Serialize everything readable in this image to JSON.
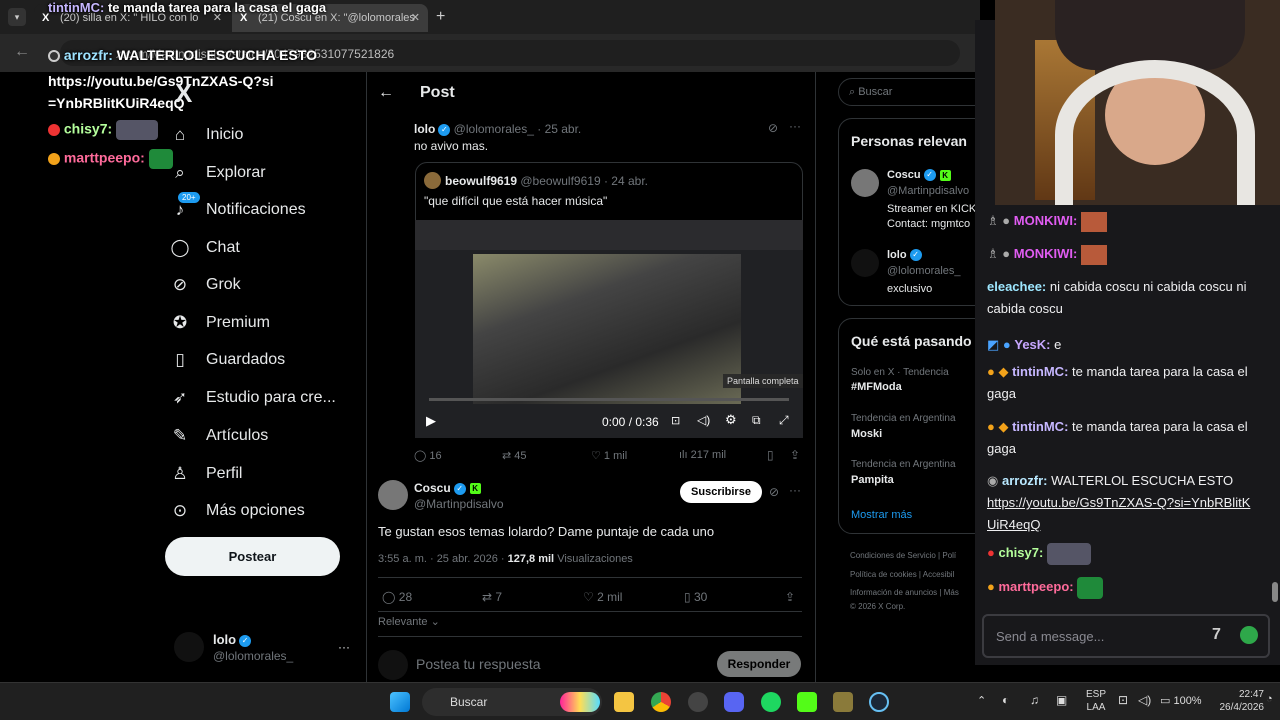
{
  "browser": {
    "tab1": "(20) silla en X: \"",
    "tab1b": "HILO con lo",
    "tab2": "(21) Coscu en X: \"@lolomorales",
    "new_tab": "+",
    "url": "x.com/Martinpdisalvo/status/2047932531077521826",
    "back": "←"
  },
  "overlay": [
    {
      "user": "tintinMC:",
      "text": "te manda tarea para la casa el gaga"
    },
    {
      "user": "arrozfr:",
      "text": "WALTERLOL ESCUCHA ESTO"
    },
    {
      "user": "",
      "text": "https://youtu.be/Gs9TnZXAS-Q?si=YnbRBlitKUiR4eqQ"
    },
    {
      "user": "chisy7:",
      "text": ""
    },
    {
      "user": "marttpeepo:",
      "text": ""
    }
  ],
  "nav": {
    "logo": "X",
    "items": [
      "Inicio",
      "Explorar",
      "Notificaciones",
      "Chat",
      "Grok",
      "Premium",
      "Guardados",
      "Estudio para cre...",
      "Artículos",
      "Perfil",
      "Más opciones"
    ],
    "notif_badge": "20+",
    "post_button": "Postear",
    "account_name": "lolo",
    "account_handle": "@lolomorales_",
    "more": "···"
  },
  "post": {
    "header": "Post",
    "back": "←",
    "tweet1": {
      "name": "lolo",
      "handle": "@lolomorales_",
      "date": "· 25 abr.",
      "text": "no avivo mas."
    },
    "quote": {
      "name": "beowulf9619",
      "handle": "@beowulf9619",
      "date": "· 24 abr.",
      "text": "\"que difícil que está hacer música\"",
      "time": "0:00 / 0:36",
      "fullscreen": "Pantalla completa"
    },
    "stats1": {
      "replies": "16",
      "retweets": "45",
      "likes": "1 mil",
      "views": "217 mil"
    },
    "tweet2": {
      "name": "Coscu",
      "handle": "@Martinpdisalvo",
      "subscribe": "Suscribirse",
      "text": "Te gustan esos temas lolardo? Dame puntaje de cada uno",
      "meta": "3:55 a. m. · 25 abr. 2026 · ",
      "views_num": "127,8 mil",
      "views_label": "Visualizaciones"
    },
    "stats2": {
      "replies": "28",
      "retweets": "7",
      "likes": "2 mil",
      "bookmarks": "30"
    },
    "sort": "Relevante",
    "reply_placeholder": "Postea tu respuesta",
    "reply_button": "Responder"
  },
  "right": {
    "search": "Buscar",
    "people_title": "Personas relevan",
    "p1_name": "Coscu",
    "p1_handle": "@Martinpdisalvo",
    "p1_bio1": "Streamer en KICK",
    "p1_bio2": "Contact: mgmtco",
    "p2_name": "lolo",
    "p2_handle": "@lolomorales_",
    "p2_bio": "exclusivo",
    "trends_title": "Qué está pasando",
    "t1_ctx": "Solo en X · Tendencia",
    "t1": "#MFModa",
    "t2_ctx": "Tendencia en Argentina",
    "t2": "Moski",
    "t3_ctx": "Tendencia en Argentina",
    "t3": "Pampita",
    "show_more": "Mostrar más",
    "footer1": "Condiciones de Servicio",
    "footer1b": "Polí",
    "footer2": "Política de cookies",
    "footer2b": "Accesibil",
    "footer3": "Información de anuncios",
    "footer3b": "Más",
    "footer4": "© 2026 X Corp."
  },
  "chat": {
    "lines": [
      {
        "user": "MONKIWI:",
        "text": "",
        "color": "#e05cf2"
      },
      {
        "user": "MONKIWI:",
        "text": "",
        "color": "#e05cf2"
      },
      {
        "user": "eleachee:",
        "text": "ni cabida coscu  ni cabida coscu  ni cabida coscu",
        "color": "#9ee7ff"
      },
      {
        "user": "YesK:",
        "text": "e",
        "color": "#c7a7ff"
      },
      {
        "user": "tintinMC:",
        "text": "te manda tarea para la casa el gaga",
        "color": "#c6b7ff"
      },
      {
        "user": "tintinMC:",
        "text": "te manda tarea para la casa el gaga",
        "color": "#c6b7ff"
      },
      {
        "user": "arrozfr:",
        "text": "WALTERLOL ESCUCHA ESTO",
        "color": "#b9e8ff"
      },
      {
        "user": "",
        "text": "https://youtu.be/Gs9TnZXAS-Q?si=YnbRBlitKUiR4eqQ",
        "color": "#efeff1"
      },
      {
        "user": "chisy7:",
        "text": "",
        "color": "#b5ff9c"
      },
      {
        "user": "marttpeepo:",
        "text": "",
        "color": "#ff6b9b"
      }
    ],
    "send_placeholder": "Send a message..."
  },
  "taskbar": {
    "search": "Buscar",
    "lang1": "ESP",
    "lang2": "LAA",
    "battery": "100%",
    "time": "22:47",
    "date": "26/4/2026"
  }
}
